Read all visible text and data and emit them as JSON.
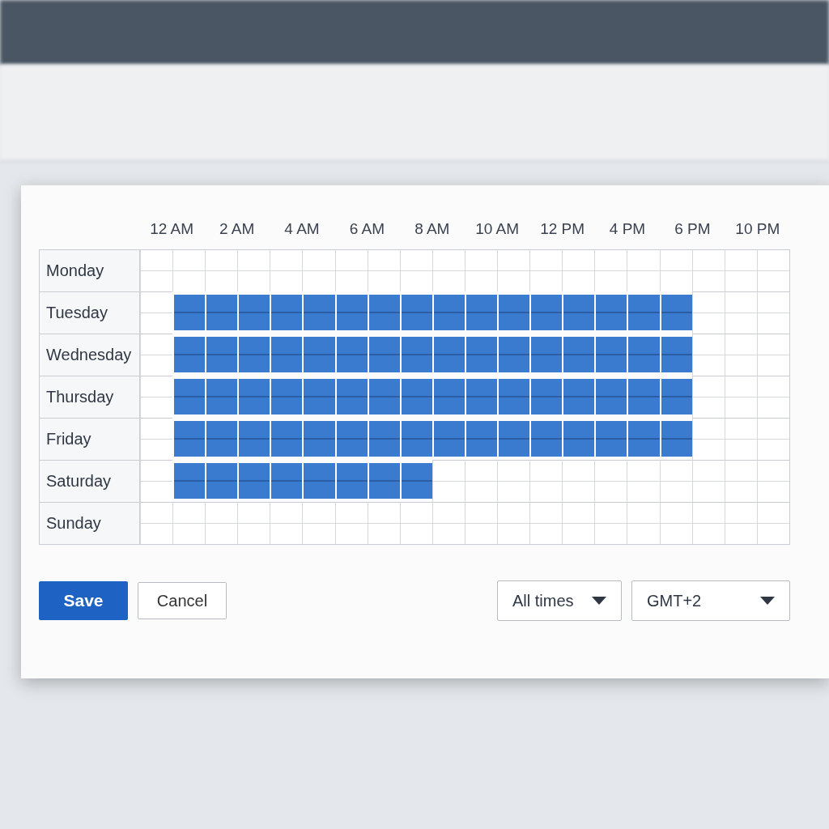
{
  "time_labels": [
    "12 AM",
    "2 AM",
    "4 AM",
    "6 AM",
    "8 AM",
    "10 AM",
    "12 PM",
    "4 PM",
    "6 PM",
    "10 PM"
  ],
  "days": [
    {
      "label": "Monday",
      "slots": [
        false,
        false,
        false,
        false,
        false,
        false,
        false,
        false,
        false,
        false,
        false,
        false,
        false,
        false,
        false,
        false,
        false,
        false,
        false,
        false
      ]
    },
    {
      "label": "Tuesday",
      "slots": [
        false,
        true,
        true,
        true,
        true,
        true,
        true,
        true,
        true,
        true,
        true,
        true,
        true,
        true,
        true,
        true,
        true,
        false,
        false,
        false
      ]
    },
    {
      "label": "Wednesday",
      "slots": [
        false,
        true,
        true,
        true,
        true,
        true,
        true,
        true,
        true,
        true,
        true,
        true,
        true,
        true,
        true,
        true,
        true,
        false,
        false,
        false
      ]
    },
    {
      "label": "Thursday",
      "slots": [
        false,
        true,
        true,
        true,
        true,
        true,
        true,
        true,
        true,
        true,
        true,
        true,
        true,
        true,
        true,
        true,
        true,
        false,
        false,
        false
      ]
    },
    {
      "label": "Friday",
      "slots": [
        false,
        true,
        true,
        true,
        true,
        true,
        true,
        true,
        true,
        true,
        true,
        true,
        true,
        true,
        true,
        true,
        true,
        false,
        false,
        false
      ]
    },
    {
      "label": "Saturday",
      "slots": [
        false,
        true,
        true,
        true,
        true,
        true,
        true,
        true,
        true,
        false,
        false,
        false,
        false,
        false,
        false,
        false,
        false,
        false,
        false,
        false
      ]
    },
    {
      "label": "Sunday",
      "slots": [
        false,
        false,
        false,
        false,
        false,
        false,
        false,
        false,
        false,
        false,
        false,
        false,
        false,
        false,
        false,
        false,
        false,
        false,
        false,
        false
      ]
    }
  ],
  "buttons": [
    {
      "label": "Save",
      "kind": "primary"
    },
    {
      "label": "Cancel",
      "kind": "secondary"
    }
  ],
  "dropdowns": [
    {
      "value": "All times"
    },
    {
      "value": "GMT+2"
    }
  ]
}
